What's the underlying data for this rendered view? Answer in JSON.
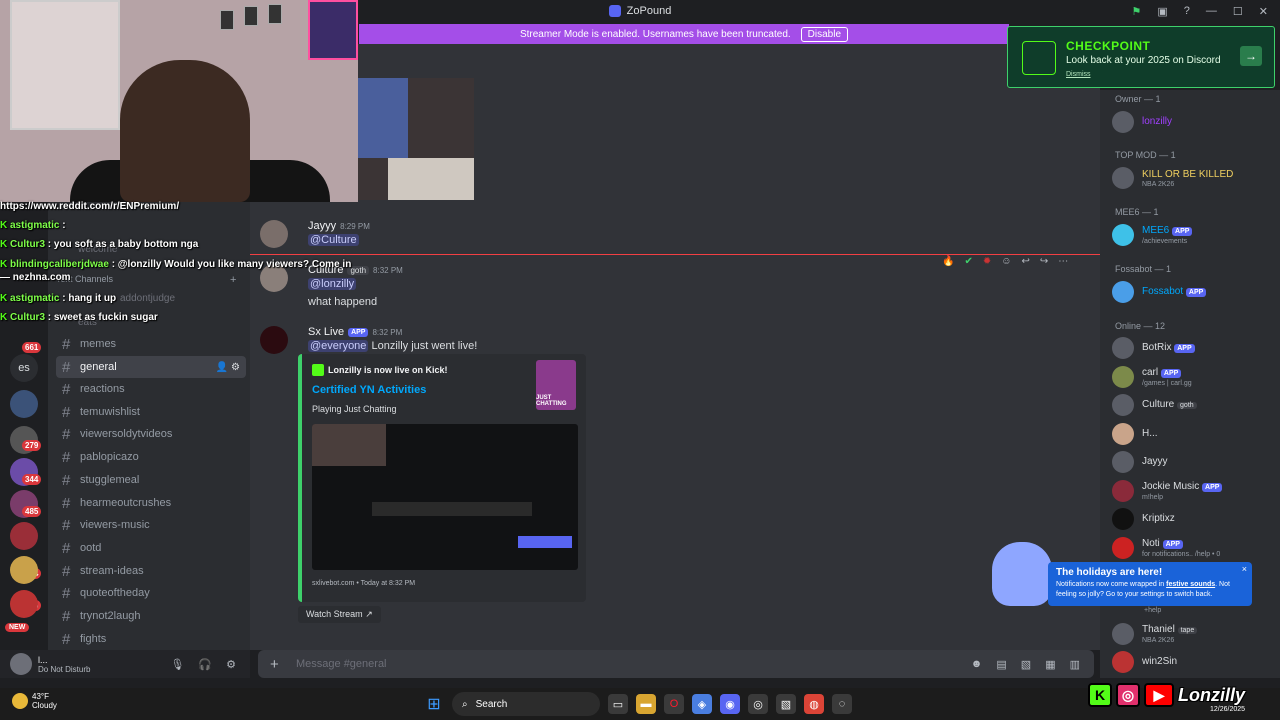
{
  "titlebar": {
    "title": "ZoPound"
  },
  "banner": {
    "text": "Streamer Mode is enabled. Usernames have been truncated.",
    "button": "Disable"
  },
  "checkpoint": {
    "title": "CHECKPOINT",
    "subtitle": "Look back at your 2025 on Discord",
    "dismiss": "Dismiss",
    "arrow": "→"
  },
  "overlay": {
    "lines": [
      {
        "user": "",
        "text": "https://www.reddit.com/r/ENPremium/"
      },
      {
        "user": "astigmatic",
        "text": ":"
      },
      {
        "user": "Cultur3",
        "text": ": you soft as a baby bottom nga"
      },
      {
        "user": "blindingcaliberjdwae",
        "text": ": @lonzilly Would you like many viewers? Come in — nezhna.com"
      },
      {
        "user": "astigmatic",
        "text": ": hang it up"
      },
      {
        "user": "Cultur3",
        "text": ": sweet as fuckin sugar"
      }
    ]
  },
  "rail": {
    "badges": [
      "661",
      "279",
      "344",
      "485",
      "564",
      "466"
    ],
    "es": "es",
    "new": "NEW"
  },
  "channels": {
    "section": "Text Channels",
    "items": [
      "memes",
      "general",
      "reactions",
      "temuwishlist",
      "viewersoldytvideos",
      "pablopicazo",
      "stugglemeal",
      "hearmeoutcrushes",
      "viewers-music",
      "ootd",
      "stream-ideas",
      "quoteoftheday",
      "trynot2laugh",
      "fights"
    ],
    "partial_items": [
      "welcome",
      "addontjudge",
      "eats"
    ]
  },
  "user": {
    "name": "l...",
    "status": "Do Not Disturb"
  },
  "messages": [
    {
      "author": "Jayyy",
      "time": "8:29 PM",
      "body": "@Culture"
    },
    {
      "author": "Culture",
      "tag": "goth",
      "time": "8:32 PM",
      "mention": "@lonzilly",
      "body": "what happend"
    },
    {
      "author": "Sx Live",
      "app": "APP",
      "time": "8:32 PM",
      "mention": "@everyone",
      "body": "Lonzilly just went live!"
    }
  ],
  "embed": {
    "provider": "Lonzilly is now live on Kick!",
    "title": "Certified YN Activities",
    "description": "Playing Just Chatting",
    "thumb": "JUST CHATTING",
    "footer": "sxlivebot.com • Today at 8:32 PM",
    "watch": "Watch Stream"
  },
  "composer": {
    "placeholder": "Message #general"
  },
  "members": {
    "groups": [
      {
        "label": "Owner — 1"
      },
      {
        "label": "TOP MOD — 1"
      },
      {
        "label": "MEE6 — 1"
      },
      {
        "label": "Fossabot — 1"
      },
      {
        "label": "Online — 12"
      }
    ],
    "list": [
      {
        "name": "lonzilly",
        "sub": "",
        "color": "#a040ff"
      },
      {
        "name": "KILL OR BE KILLED",
        "sub": "NBA 2K26",
        "color": "#f0d060"
      },
      {
        "name": "MEE6",
        "sub": "/achievements",
        "app": "APP",
        "color": "#00a8fc"
      },
      {
        "name": "Fossabot",
        "sub": "",
        "app": "APP",
        "color": "#00a8fc"
      },
      {
        "name": "BotRix",
        "sub": "",
        "app": "APP",
        "color": "#dbdee1"
      },
      {
        "name": "carl",
        "sub": "/games | carl.gg",
        "app": "APP",
        "color": "#dbdee1"
      },
      {
        "name": "Culture",
        "sub": "",
        "tag": "goth",
        "color": "#dbdee1"
      },
      {
        "name": "H...",
        "sub": "",
        "color": "#dbdee1"
      },
      {
        "name": "Jayyy",
        "sub": "",
        "color": "#dbdee1"
      },
      {
        "name": "Jockie Music",
        "sub": "m!help",
        "app": "APP",
        "color": "#dbdee1"
      },
      {
        "name": "Kriptixz",
        "sub": "",
        "color": "#dbdee1"
      },
      {
        "name": "Noti",
        "sub": "for notifications.. /help • 0",
        "app": "APP",
        "color": "#dbdee1"
      },
      {
        "name": "Thaniel",
        "sub": "NBA 2K26",
        "tag": "tape",
        "color": "#dbdee1"
      },
      {
        "name": "win2Sin",
        "sub": "",
        "color": "#dbdee1"
      }
    ],
    "partial": "+help"
  },
  "holiday": {
    "title": "The holidays are here!",
    "body_pre": "Notifications now come wrapped in",
    "body_link": "festive sounds",
    "body_post": ". Not feeling so jolly? Go to your settings to switch back.",
    "close": "×"
  },
  "taskbar": {
    "temp": "43°F",
    "weather": "Cloudy",
    "search": "Search",
    "date": "12/26/2025"
  },
  "brand": {
    "name": "Lonzilly"
  },
  "colors": {
    "discord_bg": "#313338",
    "streamer_banner": "#a44ee8",
    "kick_green": "#53fc18",
    "holiday_blue": "#1a63d9"
  }
}
